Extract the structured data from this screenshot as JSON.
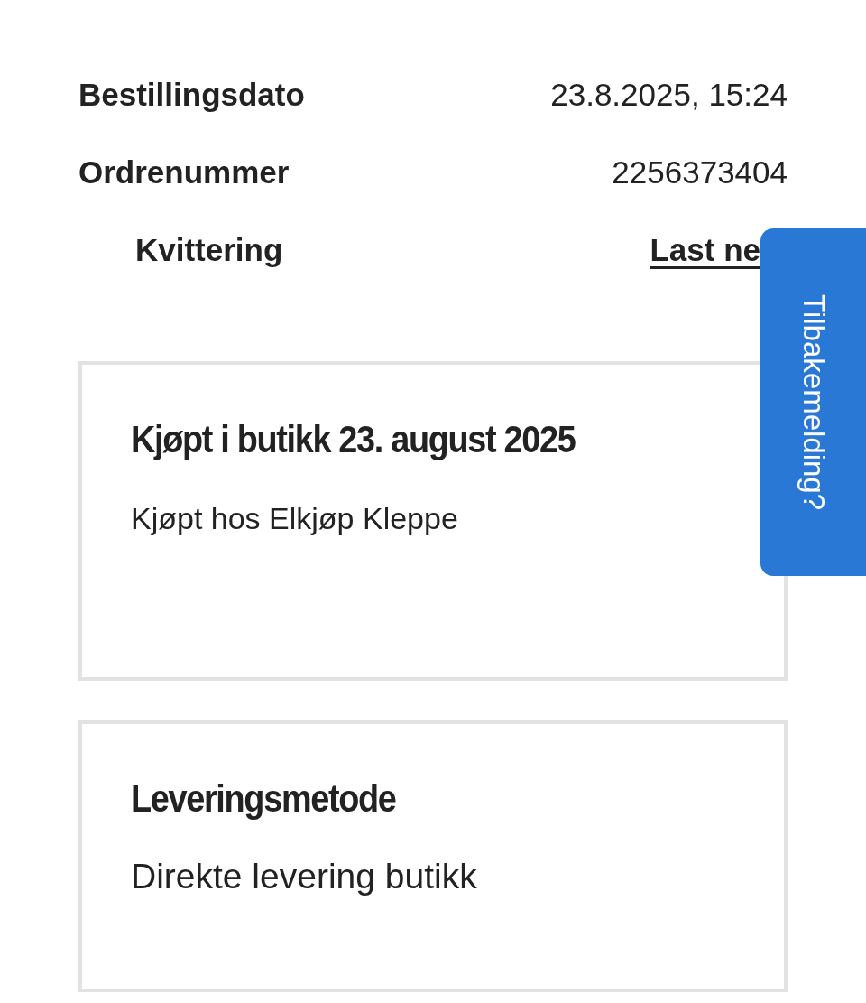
{
  "order_info": [
    {
      "label": "Bestillingsdato",
      "value": "23.8.2025, 15:24",
      "kind": "text"
    },
    {
      "label": "Ordrenummer",
      "value": "2256373404",
      "kind": "text"
    },
    {
      "label": "Kvittering",
      "value": "Last ne",
      "kind": "link"
    }
  ],
  "cards": [
    {
      "title": "Kjøpt i butikk 23. august 2025",
      "text": "Kjøpt hos Elkjøp Kleppe"
    },
    {
      "title": "Leveringsmetode",
      "text": "Direkte levering butikk"
    }
  ],
  "feedback_tab": {
    "label": "Tilbakemelding?"
  }
}
